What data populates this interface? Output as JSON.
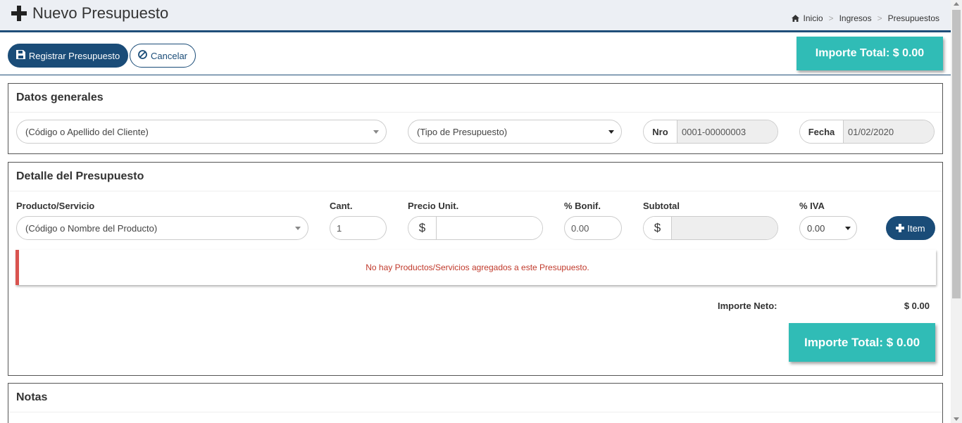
{
  "header": {
    "title": "Nuevo Presupuesto",
    "title_icon": "plus-icon",
    "breadcrumb": [
      "Inicio",
      "Ingresos",
      "Presupuestos"
    ],
    "breadcrumb_home_icon": "home-icon"
  },
  "toolbar": {
    "register_label": "Registrar Presupuesto",
    "register_icon": "save-icon",
    "cancel_label": "Cancelar",
    "cancel_icon": "ban-icon",
    "total_label": "Importe Total: $ 0.00"
  },
  "datos": {
    "title": "Datos generales",
    "client_placeholder": "(Código o Apellido del Cliente)",
    "type_placeholder": "(Tipo de Presupuesto)",
    "nro_label": "Nro",
    "nro_value": "0001-00000003",
    "fecha_label": "Fecha",
    "fecha_value": "01/02/2020"
  },
  "detalle": {
    "title": "Detalle del Presupuesto",
    "columns": {
      "product": "Producto/Servicio",
      "qty": "Cant.",
      "price": "Precio Unit.",
      "bonif": "% Bonif.",
      "subtotal": "Subtotal",
      "iva": "% IVA"
    },
    "product_placeholder": "(Código o Nombre del Producto)",
    "qty_value": "1",
    "currency_symbol": "$",
    "price_value": "",
    "bonif_value": "0.00",
    "subtotal_value": "",
    "iva_value": "0.00",
    "add_item_label": "Item",
    "empty_message": "No hay Productos/Servicios agregados a este Presupuesto.",
    "neto_label": "Importe Neto:",
    "neto_value": "$ 0.00",
    "total_label": "Importe Total: $ 0.00"
  },
  "notas": {
    "title": "Notas"
  },
  "colors": {
    "primary": "#1a4c78",
    "accent_teal": "#30bcb6",
    "danger": "#d9534f"
  }
}
